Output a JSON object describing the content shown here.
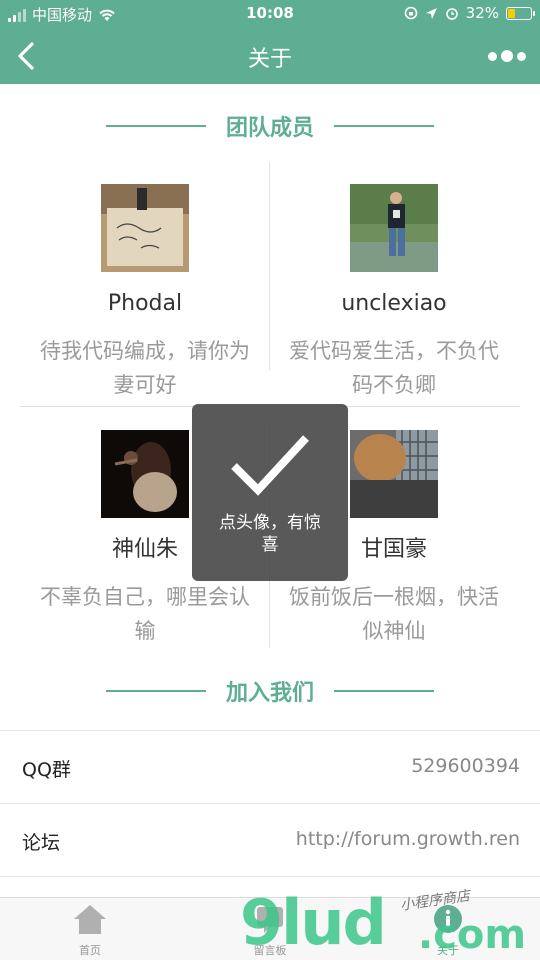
{
  "status_bar": {
    "carrier": "中国移动",
    "time": "10:08",
    "battery": "32%",
    "battery_level": 0.32
  },
  "nav": {
    "title": "关于"
  },
  "team": {
    "heading": "团队成员",
    "members": [
      {
        "name": "Phodal",
        "motto": "待我代码编成，请你为妻可好"
      },
      {
        "name": "unclexiao",
        "motto": "爱代码爱生活，不负代码不负卿"
      },
      {
        "name": "神仙朱",
        "motto": "不辜负自己，哪里会认输"
      },
      {
        "name": "甘国豪",
        "motto": "饭前饭后一根烟，快活似神仙"
      }
    ]
  },
  "join": {
    "heading": "加入我们",
    "rows": [
      {
        "label": "QQ群",
        "value": "529600394"
      },
      {
        "label": "论坛",
        "value": "http://forum.growth.ren"
      }
    ]
  },
  "tabs": [
    {
      "label": "首页",
      "icon": "home-icon"
    },
    {
      "label": "留言板",
      "icon": "message-board-icon"
    },
    {
      "label": "关于",
      "icon": "info-icon"
    }
  ],
  "toast": {
    "text": "点头像，有惊喜"
  },
  "watermark": {
    "main": "9lud",
    "suffix": ".com",
    "sub": "小程序商店"
  },
  "colors": {
    "accent": "#5eae93",
    "motto": "#9a9a9a"
  }
}
